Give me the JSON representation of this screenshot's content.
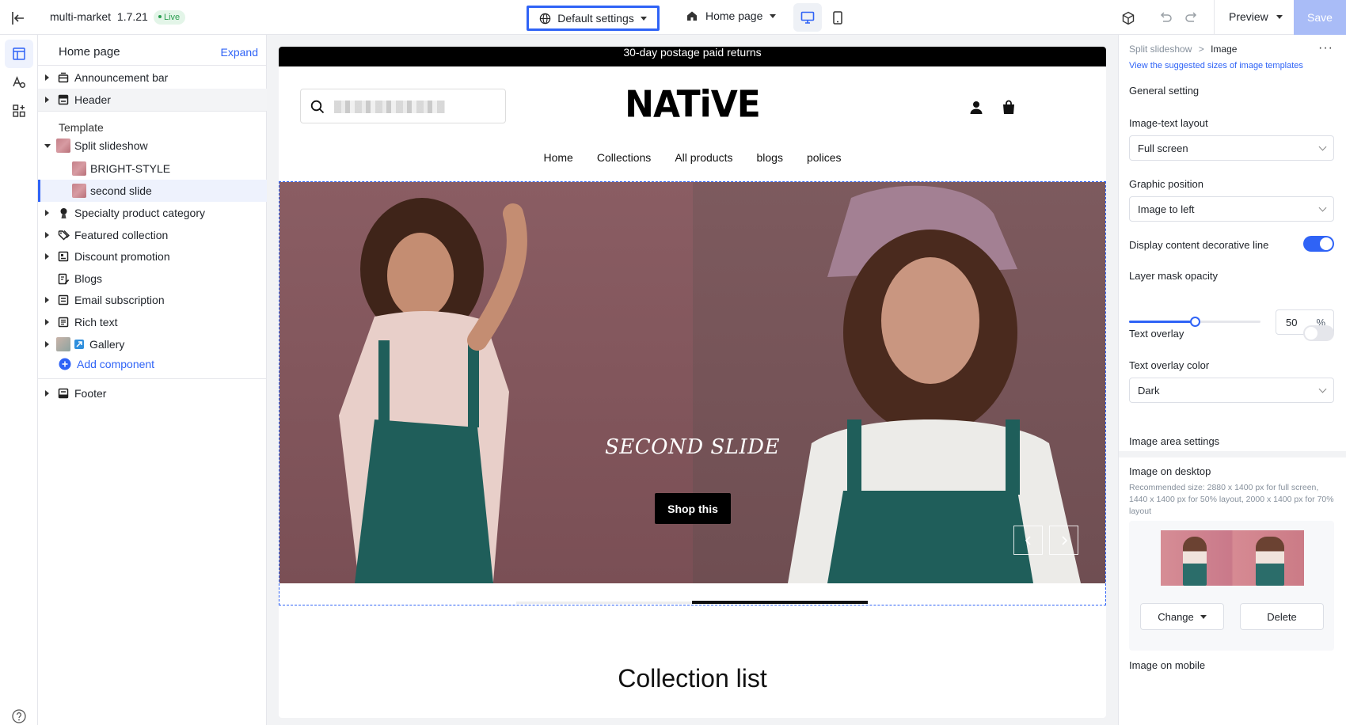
{
  "topbar": {
    "app_name": "multi-market",
    "version": "1.7.21",
    "live_badge": "Live",
    "default_settings": "Default settings",
    "page_select": "Home page",
    "preview": "Preview",
    "save": "Save"
  },
  "layers": {
    "title": "Home page",
    "expand": "Expand",
    "items": {
      "announcement": "Announcement bar",
      "header": "Header",
      "template_label": "Template",
      "split_slideshow": "Split slideshow",
      "bright_style": "BRIGHT-STYLE",
      "second_slide": "second slide",
      "specialty": "Specialty product category",
      "featured": "Featured collection",
      "discount": "Discount promotion",
      "blogs": "Blogs",
      "email": "Email subscription",
      "rich_text": "Rich text",
      "gallery": "Gallery",
      "add_component": "Add component",
      "footer": "Footer"
    }
  },
  "store": {
    "announcement": "30-day postage paid returns",
    "logo": "NATiVE",
    "nav": [
      "Home",
      "Collections",
      "All products",
      "blogs",
      "polices"
    ],
    "hero_title": "SECOND SLIDE",
    "hero_button": "Shop this",
    "slide_progress": 0.5,
    "collection_title": "Collection list"
  },
  "settings": {
    "breadcrumb_parent": "Split slideshow",
    "breadcrumb_sep": ">",
    "breadcrumb_current": "Image",
    "suggest_link": "View the suggested sizes of image templates",
    "general_heading": "General setting",
    "layout_label": "Image-text layout",
    "layout_value": "Full screen",
    "position_label": "Graphic position",
    "position_value": "Image to left",
    "decorative_line_label": "Display content decorative line",
    "decorative_line_on": true,
    "opacity_label": "Layer mask opacity",
    "opacity_value": "50",
    "opacity_unit": "%",
    "opacity_level": 0.5,
    "text_overlay_label": "Text overlay",
    "text_overlay_on": false,
    "overlay_color_label": "Text overlay color",
    "overlay_color_value": "Dark",
    "image_area_heading": "Image area settings",
    "desktop_label": "Image on desktop",
    "desktop_recommend": "Recommended size: 2880 x 1400 px for full screen, 1440 x 1400 px for 50% layout, 2000 x 1400 px for 70% layout",
    "change_btn": "Change",
    "delete_btn": "Delete",
    "mobile_label": "Image on mobile"
  },
  "colors": {
    "accent": "#2f63f6",
    "hero_overlay": "#7b5459",
    "live_green": "#2a9d4f"
  }
}
